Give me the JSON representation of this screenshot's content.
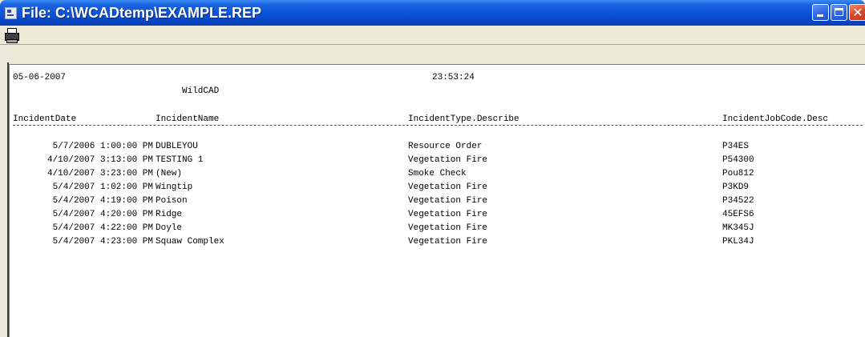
{
  "window": {
    "title": "File: C:\\WCADtemp\\EXAMPLE.REP"
  },
  "report": {
    "date": "05-06-2007",
    "time": "23:53:24",
    "app_name": "WildCAD",
    "columns": [
      "IncidentDate",
      "IncidentName",
      "IncidentType.Describe",
      "IncidentJobCode.Desc"
    ],
    "rows": [
      {
        "date": "5/7/2006 1:00:00 PM",
        "name": "DUBLEYOU",
        "type": "Resource Order",
        "code": "P34ES"
      },
      {
        "date": "4/10/2007 3:13:00 PM",
        "name": "TESTING 1",
        "type": "Vegetation Fire",
        "code": "P54300"
      },
      {
        "date": "4/10/2007 3:23:00 PM",
        "name": "(New)",
        "type": "Smoke Check",
        "code": "Pou812"
      },
      {
        "date": "5/4/2007 1:02:00 PM",
        "name": "Wingtip",
        "type": "Vegetation Fire",
        "code": "P3KD9"
      },
      {
        "date": "5/4/2007 4:19:00 PM",
        "name": "Poison",
        "type": "Vegetation Fire",
        "code": "P34522"
      },
      {
        "date": "5/4/2007 4:20:00 PM",
        "name": "Ridge",
        "type": "Vegetation Fire",
        "code": "45EFS6"
      },
      {
        "date": "5/4/2007 4:22:00 PM",
        "name": "Doyle",
        "type": "Vegetation Fire",
        "code": "MK345J"
      },
      {
        "date": "5/4/2007 4:23:00 PM",
        "name": "Squaw Complex",
        "type": "Vegetation Fire",
        "code": "PKL34J"
      }
    ]
  },
  "icons": {
    "app": "document-icon",
    "print": "printer-icon",
    "minimize": "minimize-icon",
    "maximize": "maximize-icon",
    "close": "close-icon"
  },
  "colors": {
    "titlebar": "#0a52d8",
    "close_button": "#d9462a",
    "chrome": "#ece9d8"
  }
}
